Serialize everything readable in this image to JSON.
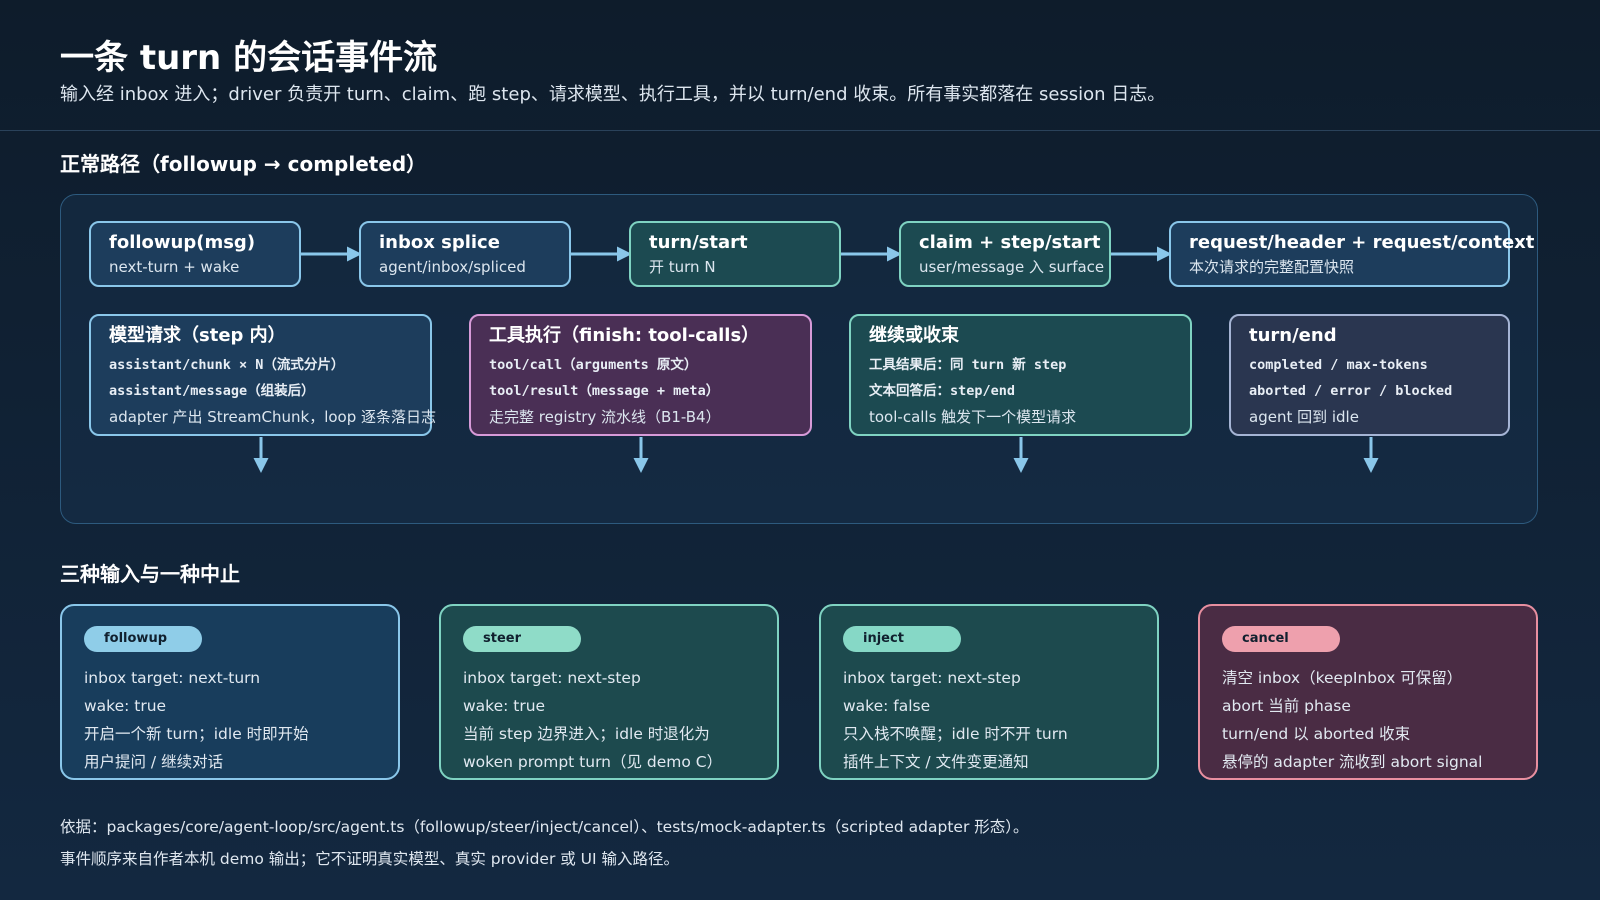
{
  "header": {
    "title": "一条 turn 的会话事件流",
    "subtitle": "输入经 inbox 进入；driver 负责开 turn、claim、跑 step、请求模型、执行工具，并以 turn/end 收束。所有事实都落在 session 日志。"
  },
  "normal_path": {
    "section_title": "正常路径（followup → completed）",
    "top_nodes": [
      {
        "title": "followup(msg)",
        "sub": "next-turn + wake"
      },
      {
        "title": "inbox splice",
        "sub": "agent/inbox/spliced"
      },
      {
        "title": "turn/start",
        "sub": "开 turn N"
      },
      {
        "title": "claim + step/start",
        "sub": "user/message 入 surface"
      },
      {
        "title": "request/header + request/context",
        "sub": "本次请求的完整配置快照"
      }
    ],
    "bottom_nodes": [
      {
        "title": "模型请求（step 内）",
        "line1": "assistant/chunk × N（流式分片）",
        "line2": "assistant/message（组装后）",
        "line3": "adapter 产出 StreamChunk，loop 逐条落日志"
      },
      {
        "title": "工具执行（finish: tool-calls）",
        "line1": "tool/call（arguments 原文）",
        "line2": "tool/result（message + meta）",
        "line3": "走完整 registry 流水线（B1-B4）"
      },
      {
        "title": "继续或收束",
        "line1": "工具结果后：同 turn 新 step",
        "line2": "文本回答后：step/end",
        "line3": "tool-calls 触发下一个模型请求"
      },
      {
        "title": "turn/end",
        "line1": "completed / max-tokens",
        "line2": "aborted / error / blocked",
        "line3": "agent 回到 idle"
      }
    ]
  },
  "inputs": {
    "section_title": "三种输入与一种中止",
    "cards": [
      {
        "pill": "followup",
        "pill_color": "#8fcde8",
        "lines": [
          "inbox target: next-turn",
          "wake: true",
          "开启一个新 turn；idle 时即开始",
          "用户提问 / 继续对话"
        ]
      },
      {
        "pill": "steer",
        "pill_color": "#8fdcc8",
        "lines": [
          "inbox target: next-step",
          "wake: true",
          "当前 step 边界进入；idle 时退化为",
          "woken prompt turn（见 demo C）"
        ]
      },
      {
        "pill": "inject",
        "pill_color": "#86d8c6",
        "lines": [
          "inbox target: next-step",
          "wake: false",
          "只入栈不唤醒；idle 时不开 turn",
          "插件上下文 / 文件变更通知"
        ]
      },
      {
        "pill": "cancel",
        "pill_color": "#eea0ad",
        "lines": [
          "清空 inbox（keepInbox 可保留）",
          "abort 当前 phase",
          "turn/end 以 aborted 收束",
          "悬停的 adapter 流收到 abort signal"
        ]
      }
    ]
  },
  "footer": {
    "line1": "依据：packages/core/agent-loop/src/agent.ts（followup/steer/inject/cancel）、tests/mock-adapter.ts（scripted adapter 形态）。",
    "line2": "事件顺序来自作者本机 demo 输出；它不证明真实模型、真实 provider 或 UI 输入路径。"
  },
  "colors": {
    "arrow": "#8ac7ea",
    "background": "#0e1c2b"
  }
}
